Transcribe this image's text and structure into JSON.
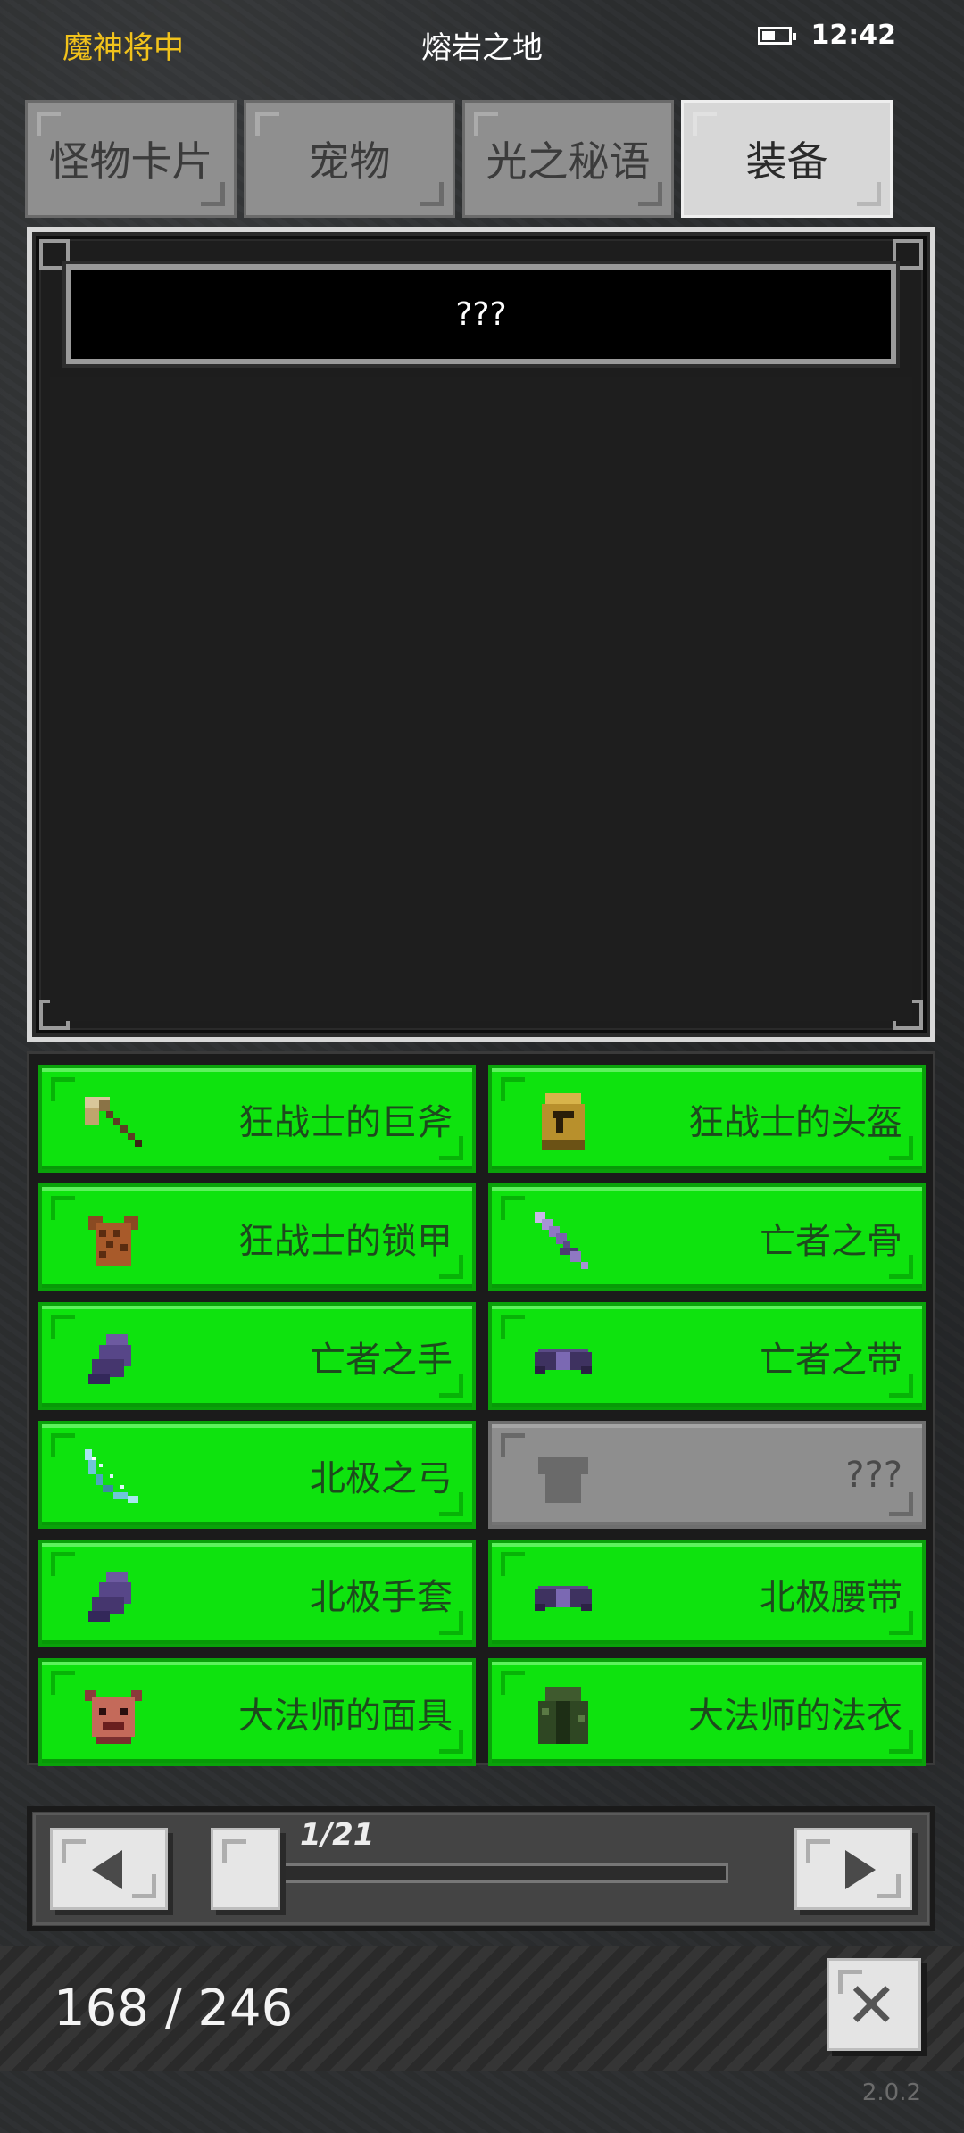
{
  "status_bar": {
    "title_label": "魔神将中",
    "location": "熔岩之地",
    "time": "12:42"
  },
  "tabs": [
    {
      "label": "怪物卡片",
      "active": false
    },
    {
      "label": "宠物",
      "active": false
    },
    {
      "label": "光之秘语",
      "active": false
    },
    {
      "label": "装备",
      "active": true
    }
  ],
  "preview": {
    "title": "???"
  },
  "items": [
    {
      "label": "狂战士的巨斧",
      "icon": "axe-icon",
      "locked": false
    },
    {
      "label": "狂战士的头盔",
      "icon": "helmet-icon",
      "locked": false
    },
    {
      "label": "狂战士的锁甲",
      "icon": "armor-icon",
      "locked": false
    },
    {
      "label": "亡者之骨",
      "icon": "bone-sword-icon",
      "locked": false
    },
    {
      "label": "亡者之手",
      "icon": "glove-icon",
      "locked": false
    },
    {
      "label": "亡者之带",
      "icon": "belt-icon",
      "locked": false
    },
    {
      "label": "北极之弓",
      "icon": "bow-icon",
      "locked": false
    },
    {
      "label": "???",
      "icon": "unknown-armor-icon",
      "locked": true
    },
    {
      "label": "北极手套",
      "icon": "glove-icon",
      "locked": false
    },
    {
      "label": "北极腰带",
      "icon": "belt-icon",
      "locked": false
    },
    {
      "label": "大法师的面具",
      "icon": "mask-icon",
      "locked": false
    },
    {
      "label": "大法师的法衣",
      "icon": "robe-icon",
      "locked": false
    }
  ],
  "pager": {
    "page_text": "1/21",
    "current_page": 1,
    "total_pages": 21
  },
  "footer": {
    "count": "168 / 246",
    "version": "2.0.2"
  },
  "colors": {
    "slot_green": "#0ee30e",
    "slot_locked": "#8e8e8e",
    "status_gold": "#f1c21b"
  }
}
